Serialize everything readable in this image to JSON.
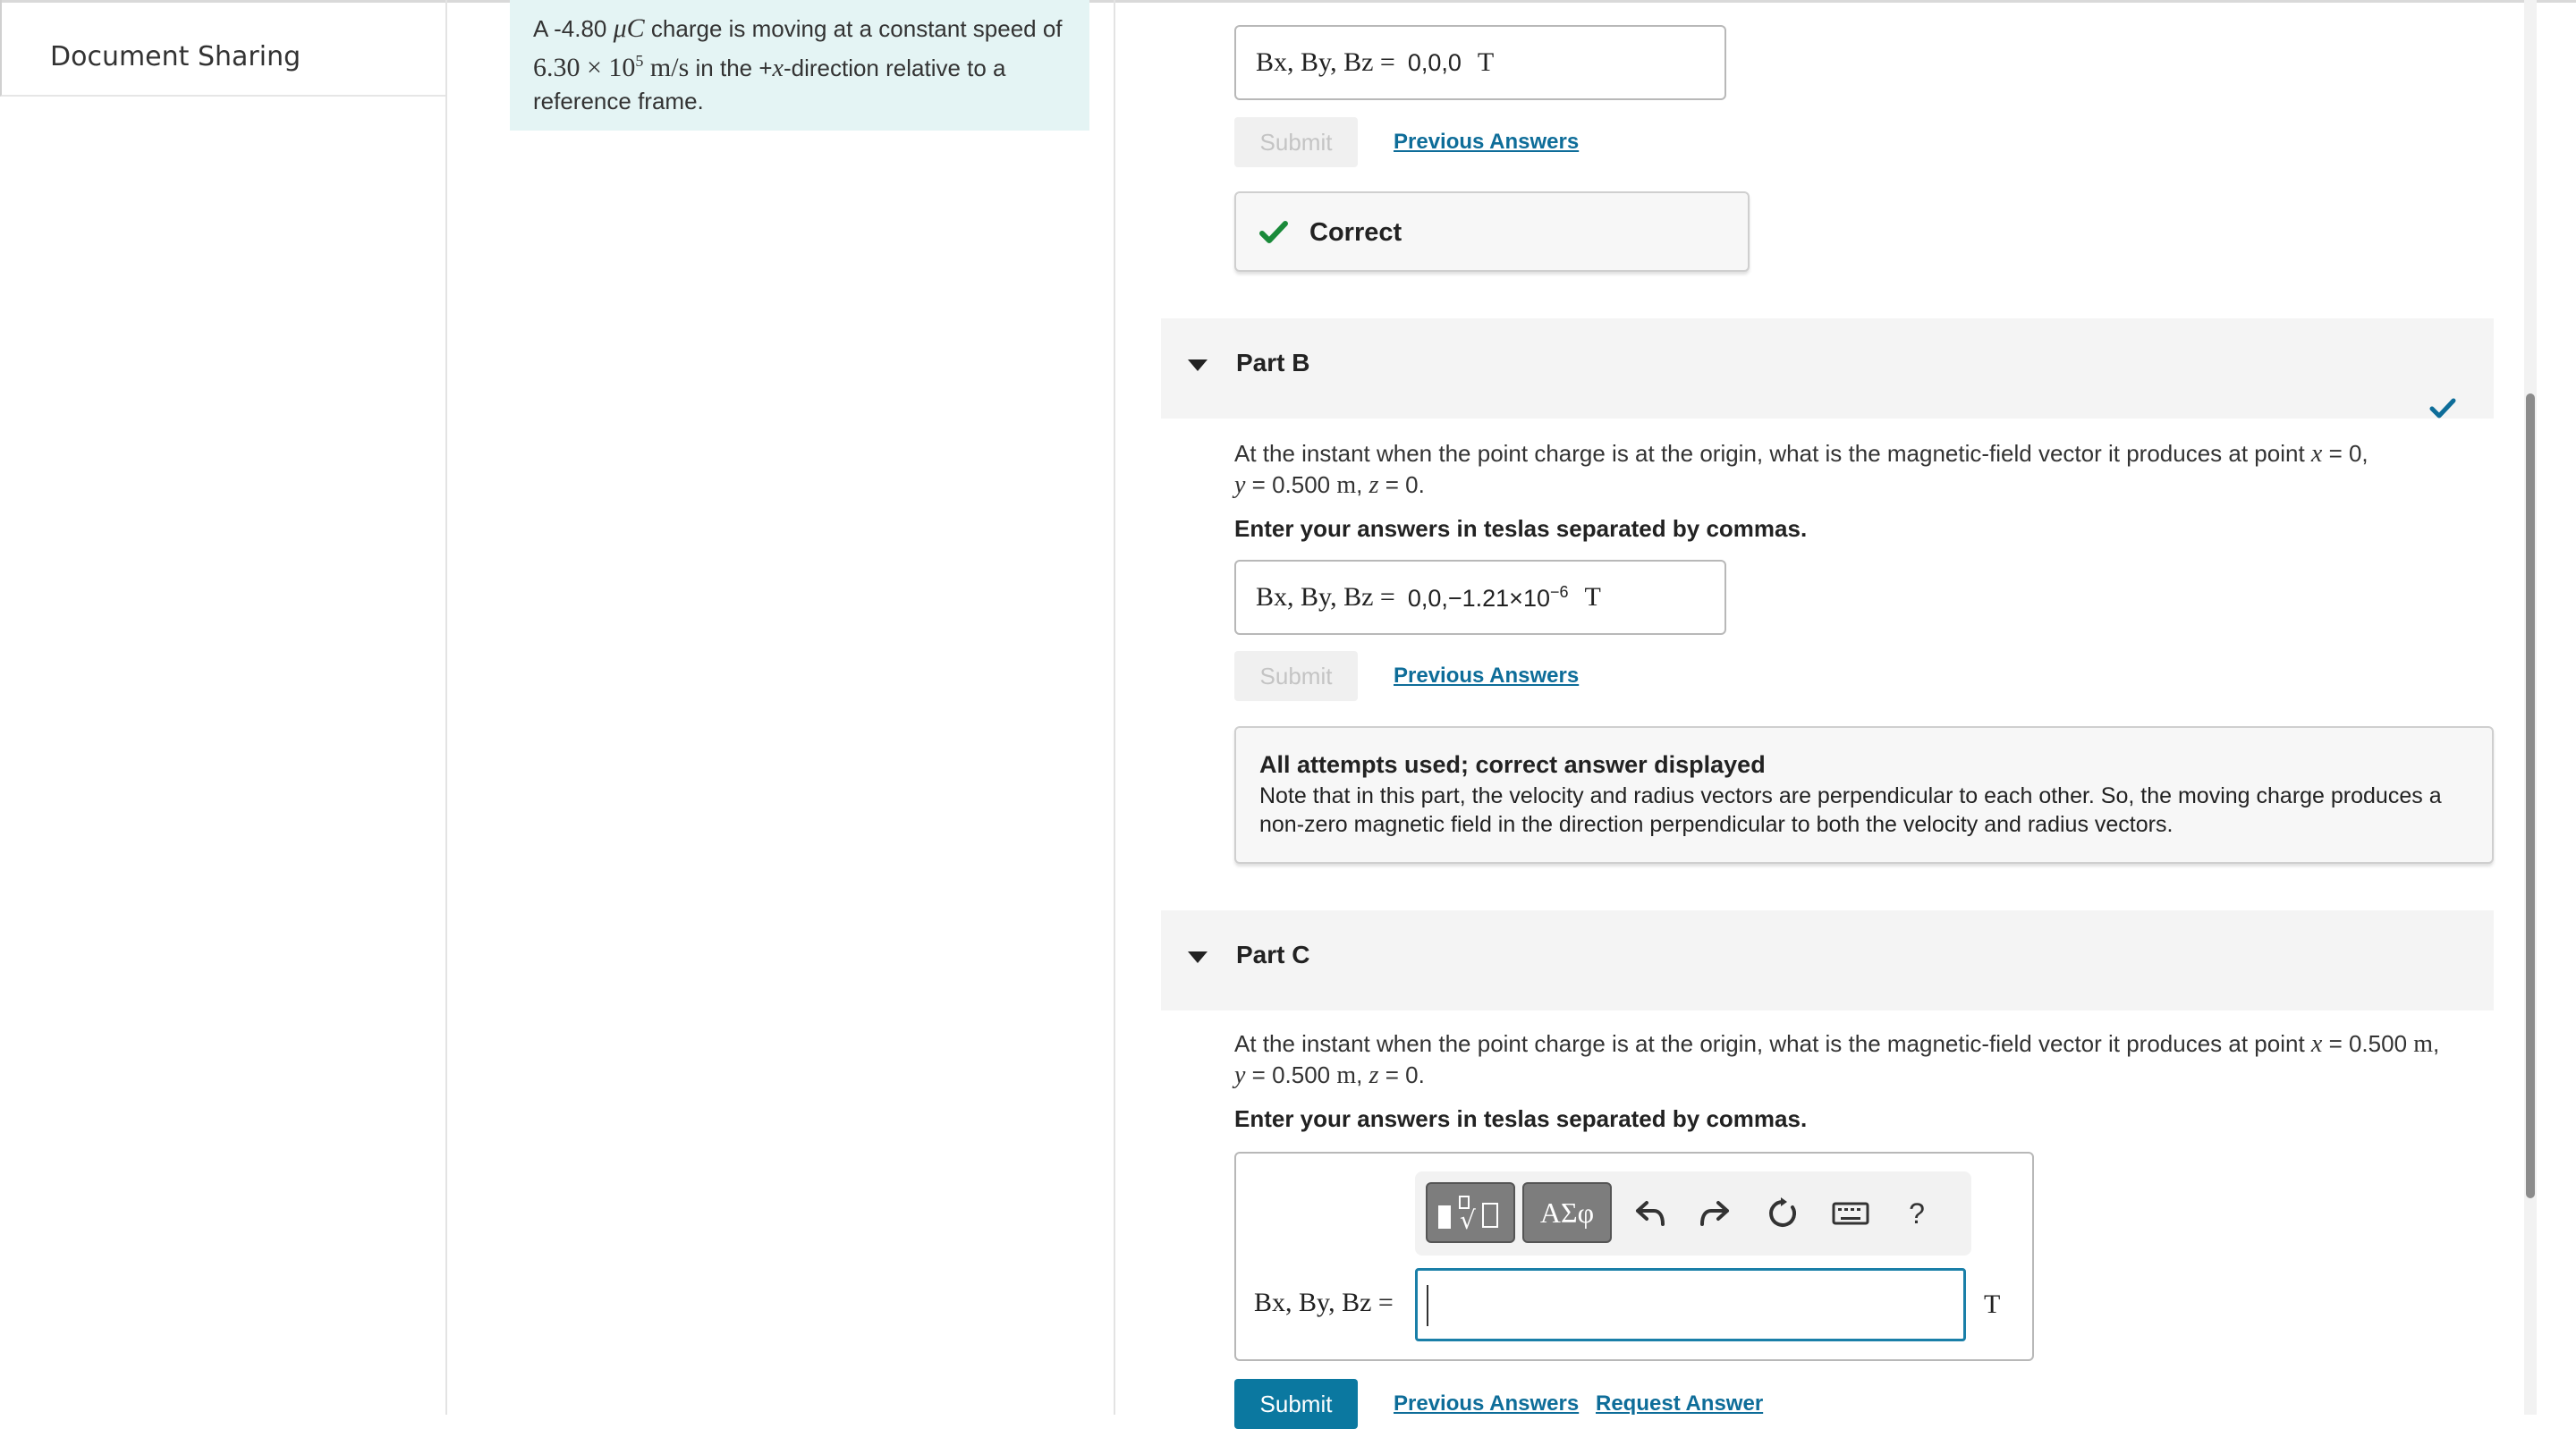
{
  "nav": {
    "item": "Document Sharing"
  },
  "problem": {
    "pre": "A -4.80 ",
    "charge_unit": "μC",
    "mid1": " charge is moving at a constant speed of ",
    "speed": "6.30 × 10",
    "speed_exp": "5",
    "speed_unit": " m/s",
    "mid2": " in the +",
    "dir_var": "x",
    "post": "-direction relative to a reference frame."
  },
  "partA": {
    "answer_label": "Bx, By, Bz =",
    "answer_value": "0,0,0",
    "unit": "T",
    "submit": "Submit",
    "previous": "Previous Answers",
    "feedback": "Correct"
  },
  "partB": {
    "title": "Part B",
    "q_line1": "At the instant when the point charge is at the origin, what is the magnetic-field vector it produces at point ",
    "q_pt1": "x",
    "q_line1_end": " = 0,",
    "q_line2_y": "y",
    "q_line2": " = 0.500 ",
    "q_line2_m": "m",
    "q_line2_z": "z",
    "q_line2_end": " = 0.",
    "instruction": "Enter your answers in teslas separated by commas.",
    "answer_label": "Bx, By, Bz =",
    "answer_value": "0,0,−1.21×10",
    "answer_exp": "−6",
    "unit": "T",
    "submit": "Submit",
    "previous": "Previous Answers",
    "fb_title": "All attempts used; correct answer displayed",
    "fb_body": "Note that in this part, the velocity and radius vectors are perpendicular to each other. So, the moving charge produces a non-zero magnetic field in the direction perpendicular to both the velocity and radius vectors."
  },
  "partC": {
    "title": "Part C",
    "q_line1": "At the instant when the point charge is at the origin, what is the magnetic-field vector it produces at point ",
    "q_x": "x",
    "q_line1_end": " = 0.500 ",
    "q_m1": "m",
    "q_y": "y",
    "q_line2": " = 0.500 ",
    "q_m2": "m",
    "q_z": "z",
    "q_line2_end": " = 0.",
    "instruction": "Enter your answers in teslas separated by commas.",
    "answer_label": "Bx, By, Bz =",
    "input_value": "",
    "unit": "T",
    "submit": "Submit",
    "previous": "Previous Answers",
    "request": "Request Answer",
    "toolbar": {
      "greek": "ΑΣφ",
      "help": "?"
    }
  },
  "colors": {
    "accent": "#0b78a0",
    "link": "#0e6d99",
    "check": "#1a8a3a",
    "problem_bg": "#e4f4f4"
  }
}
